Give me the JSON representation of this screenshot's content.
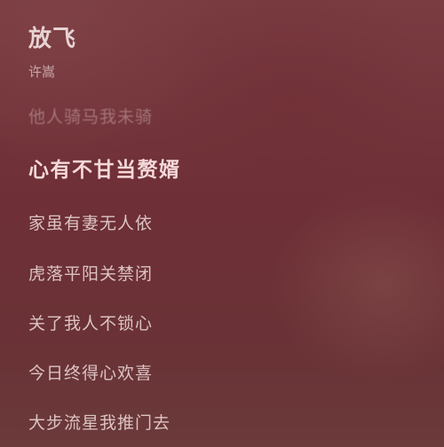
{
  "song": {
    "title": "放飞",
    "artist": "许嵩"
  },
  "lyrics": {
    "lines": [
      "他人骑马我未骑",
      "心有不甘当赘婿",
      "家虽有妻无人依",
      "虎落平阳关禁闭",
      "关了我人不锁心",
      "今日终得心欢喜",
      "大步流星我推门去"
    ],
    "current_index": 1
  }
}
